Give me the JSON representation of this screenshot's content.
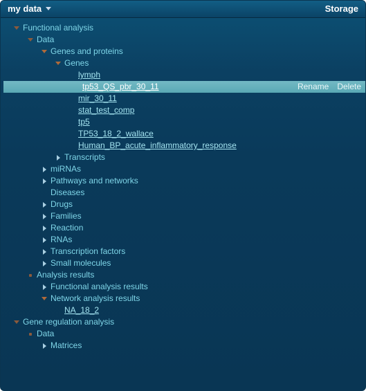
{
  "header": {
    "title": "my data",
    "right": "Storage"
  },
  "actions": {
    "rename": "Rename",
    "delete": "Delete"
  },
  "tree": {
    "functional_analysis": "Functional analysis",
    "data": "Data",
    "genes_and_proteins": "Genes and proteins",
    "genes": "Genes",
    "lymph": "lymph",
    "tp53_qs_pbr_30_11": "tp53_QS_pbr_30_11",
    "mir_30_11": "mir_30_11",
    "stat_test_comp": "stat_test_comp",
    "tp5": "tp5",
    "tp53_18_2_wallace": "TP53_18_2_wallace",
    "human_bp_acute": "Human_BP_acute_inflammatory_response",
    "transcripts": "Transcripts",
    "mirnas": "miRNAs",
    "pathways_and_networks": "Pathways and networks",
    "diseases": "Diseases",
    "drugs": "Drugs",
    "families": "Families",
    "reaction": "Reaction",
    "rnas": "RNAs",
    "transcription_factors": "Transcription factors",
    "small_molecules": "Small molecules",
    "analysis_results": "Analysis results",
    "functional_analysis_results": "Functional analysis results",
    "network_analysis_results": "Network analysis results",
    "na_18_2": "NA_18_2",
    "gene_regulation_analysis": "Gene regulation analysis",
    "data2": "Data",
    "matrices": "Matrices"
  }
}
